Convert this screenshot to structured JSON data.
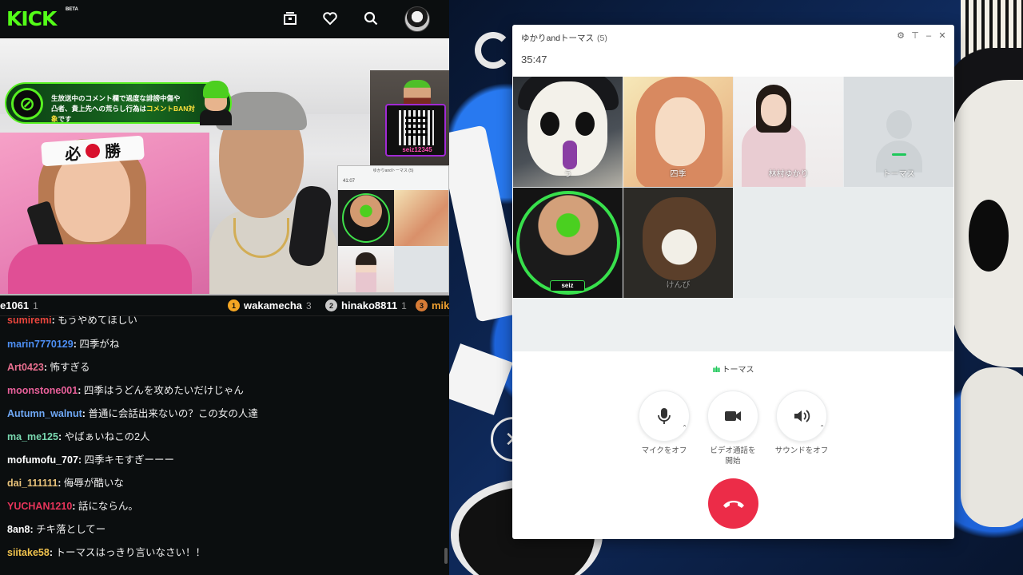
{
  "kick": {
    "logo": "KICK",
    "beta": "BETA",
    "icons": {
      "library": "library-icon",
      "heart": "heart-icon",
      "search": "search-icon"
    },
    "accent": "#53fc18"
  },
  "overlay": {
    "notice_line1": "生放送中のコメント欄で過度な誹謗中傷や",
    "notice_line2a": "凸者、貴上先への荒らし行為は",
    "notice_line2b": "コメントBAN対象",
    "notice_line2c": "です",
    "qr_label": "seiz12345",
    "headband": "必勝",
    "mini_call_title": "ゆかりandトーマス (5)",
    "mini_call_time": "41:07"
  },
  "leaderboard": [
    {
      "name": "e1061",
      "count": "1",
      "rank": ""
    },
    {
      "name": "wakamecha",
      "count": "3",
      "rank": "1"
    },
    {
      "name": "hinako8811",
      "count": "1",
      "rank": "2"
    },
    {
      "name": "mik",
      "count": "",
      "rank": "3"
    }
  ],
  "chat": [
    {
      "user": "sumiremi",
      "color": "#e8453c",
      "msg": "もうやめてほしい"
    },
    {
      "user": "marin7770129",
      "color": "#4d8ff5",
      "msg": "四季がね"
    },
    {
      "user": "Art0423",
      "color": "#e86f8f",
      "msg": "怖すぎる"
    },
    {
      "user": "moonstone001",
      "color": "#e8609a",
      "msg": "四季はうどんを攻めたいだけじゃん"
    },
    {
      "user": "Autumn_walnut",
      "color": "#6fa8f5",
      "msg": "普通に会話出来ないの？この女の人達"
    },
    {
      "user": "ma_me125",
      "color": "#79d8b0",
      "msg": "やばぁいねこの2人"
    },
    {
      "user": "mofumofu_707",
      "color": "#ffffff",
      "msg": "四季キモすぎーーー"
    },
    {
      "user": "dai_111111",
      "color": "#e8c27a",
      "msg": "侮辱が酷いな"
    },
    {
      "user": "YUCHAN1210",
      "color": "#e8345a",
      "msg": "話にならん。"
    },
    {
      "user": "8an8",
      "color": "#ffffff",
      "msg": "チキ落としてー"
    },
    {
      "user": "siitake58",
      "color": "#f0c24d",
      "msg": "トーマスはっきり言いなさい！！"
    }
  ],
  "call": {
    "title": "ゆかりandトーマス",
    "count": "(5)",
    "timer": "35:47",
    "window_buttons": {
      "settings": "gear-icon",
      "pin": "pin-icon",
      "minimize": "minimize-icon",
      "close": "close-icon"
    },
    "participants": [
      {
        "name": "う"
      },
      {
        "name": "四季"
      },
      {
        "name": "林村ゆかり"
      },
      {
        "name": "トーマス"
      },
      {
        "name": "",
        "tag": "seiz"
      },
      {
        "name": "けんび"
      }
    ],
    "speaking": "トーマス",
    "controls": {
      "mic": "マイクをオフ",
      "video_line1": "ビデオ通話を",
      "video_line2": "開始",
      "sound": "サウンドをオフ"
    },
    "speaking_color": "#1ec85a",
    "hangup_color": "#ec2c48"
  }
}
